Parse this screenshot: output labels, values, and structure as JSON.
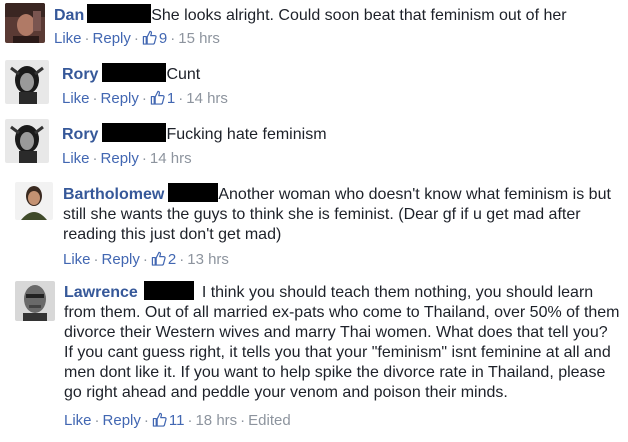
{
  "comments": [
    {
      "name": "Dan",
      "text": "She looks alright. Could soon beat that feminism out of her",
      "actions": {
        "like": "Like",
        "reply": "Reply",
        "likes": "9",
        "time": "15 hrs",
        "edited": ""
      }
    },
    {
      "name": "Rory",
      "text": "Cunt",
      "actions": {
        "like": "Like",
        "reply": "Reply",
        "likes": "1",
        "time": "14 hrs",
        "edited": ""
      }
    },
    {
      "name": "Rory",
      "text": "Fucking hate feminism",
      "actions": {
        "like": "Like",
        "reply": "Reply",
        "likes": "",
        "time": "14 hrs",
        "edited": ""
      }
    },
    {
      "name": "Bartholomew",
      "text_lines": [
        "Another woman who doesn't know what feminism is but",
        "still she wants the guys to think she is feminist. (Dear gf if u get mad after",
        "reading this just don't get mad)"
      ],
      "actions": {
        "like": "Like",
        "reply": "Reply",
        "likes": "2",
        "time": "13 hrs",
        "edited": ""
      }
    },
    {
      "name": "Lawrence",
      "text_lines": [
        "I think you should teach them nothing, you should learn",
        "from them. Out of all married ex-pats who come to Thailand, over 50% of them",
        "divorce their Western wives and marry Thai women. What does that tell you?",
        "If you cant guess right, it tells you that your \"feminism\" isnt feminine at all and",
        "men dont like it. If you want to help spike the divorce rate in Thailand, please",
        "go right ahead and peddle your venom and poison their minds."
      ],
      "actions": {
        "like": "Like",
        "reply": "Reply",
        "likes": "11",
        "time": "18 hrs",
        "edited": "Edited"
      }
    }
  ],
  "colors": {
    "name": "#365899",
    "link": "#4267b2",
    "meta": "#8d949e",
    "text": "#1d2129",
    "redaction": "#000000"
  },
  "icons": {
    "like": "thumbs-up-icon"
  }
}
